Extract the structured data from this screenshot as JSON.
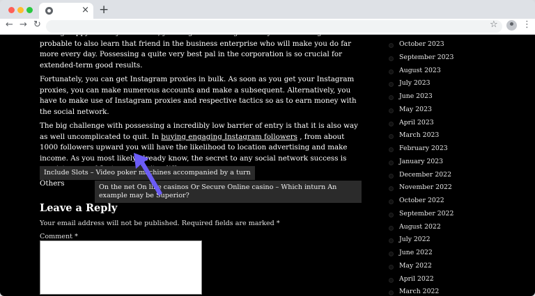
{
  "browser": {
    "tab_close_glyph": "×",
    "new_tab_glyph": "+",
    "nav_back": "←",
    "nav_forward": "→",
    "nav_reload": "↻",
    "star_glyph": "☆",
    "menu_glyph": "⋮"
  },
  "article": {
    "para_cut": "feeling happy. When you are sad, you've got sad thoughts and you are feeling sad. It is probable to also learn that friend in the business enterprise who will make you do far more every day. Possessing a quite very best pal in the corporation is so crucial for extended-term good results.",
    "para2": "Fortunately, you can get Instagram proxies in bulk. As soon as you get your Instagram proxies, you can make numerous accounts and make a subsequent. Alternatively, you have to make use of Instagram proxies and respective tactics so as to earn money with the social network.",
    "para3_before": "The big challenge with possessing a incredibly low barrier of entry is that it is also way as well uncomplicated to quit. In ",
    "para3_link": "buying engaging Instagram followers",
    "para3_after": " , from about 1000 followers upward you will have the likelihood to location advertising and make income. As you most likely already know, the secret to any social network success is consistency and Instagram isn't a difference.",
    "others": "Others",
    "prev_post": "Include Slots – Video poker machines accompanied by a turn",
    "next_post": "On the net On line casinos Or Secure Online casino – Which inturn An example may be Superior?"
  },
  "reply": {
    "title": "Leave a Reply",
    "notes": "Your email address will not be published. Required fields are marked *",
    "comment_label": "Comment *"
  },
  "sidebar": {
    "archives": [
      "October 2023",
      "September 2023",
      "August 2023",
      "July 2023",
      "June 2023",
      "May 2023",
      "April 2023",
      "March 2023",
      "February 2023",
      "January 2023",
      "December 2022",
      "November 2022",
      "October 2022",
      "September 2022",
      "August 2022",
      "July 2022",
      "June 2022",
      "May 2022",
      "April 2022",
      "March 2022"
    ]
  },
  "colors": {
    "page_bg": "#000000",
    "arrow": "#6b5cf6"
  }
}
